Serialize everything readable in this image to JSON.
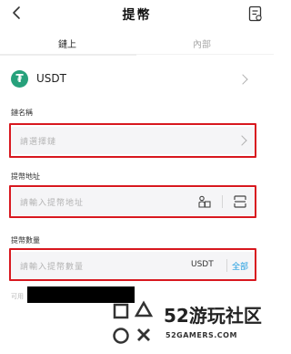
{
  "header": {
    "title": "提幣"
  },
  "tabs": [
    {
      "label": "鏈上"
    },
    {
      "label": "內部"
    }
  ],
  "coin": {
    "symbol": "USDT"
  },
  "network": {
    "label": "鏈名稱",
    "placeholder": "請選擇鏈"
  },
  "address": {
    "label": "提幣地址",
    "placeholder": "請輸入提幣地址"
  },
  "amount": {
    "label": "提幣數量",
    "placeholder": "請輸入提幣數量",
    "unit": "USDT",
    "all_label": "全部"
  },
  "available": {
    "label": "可用"
  },
  "watermark": {
    "brand": "52游玩社区",
    "site": "52GAMERS.COM"
  },
  "colors": {
    "highlight": "#d8181f",
    "accent": "#1e9de0",
    "tether": "#26a17b"
  }
}
